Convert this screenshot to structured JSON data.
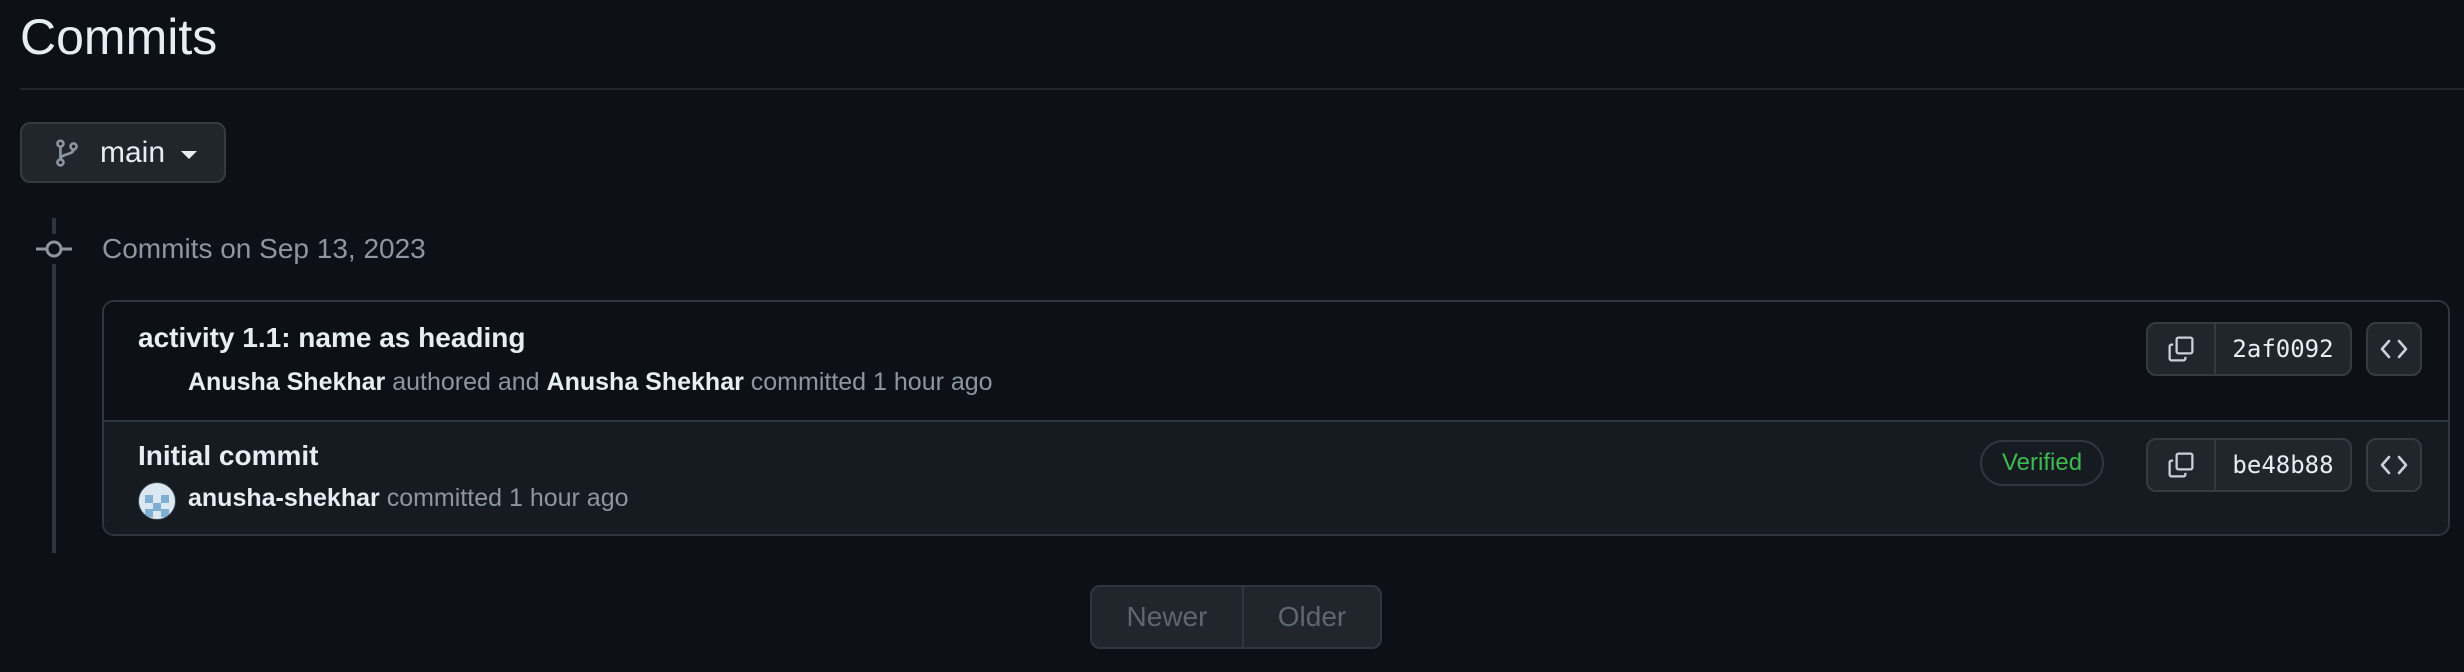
{
  "page": {
    "title": "Commits"
  },
  "branch": {
    "name": "main",
    "icon": "git-branch-icon"
  },
  "group": {
    "heading": "Commits on Sep 13, 2023",
    "icon": "git-commit-icon"
  },
  "commits": [
    {
      "title": "activity 1.1: name as heading",
      "author": "Anusha Shekhar",
      "authored_text": "authored and",
      "committer": "Anusha Shekhar",
      "committed_text": "committed",
      "time": "1 hour ago",
      "sha": "2af0092",
      "verified": null
    },
    {
      "title": "Initial commit",
      "author": "anusha-shekhar",
      "committed_text": "committed",
      "time": "1 hour ago",
      "sha": "be48b88",
      "verified": "Verified"
    }
  ],
  "pagination": {
    "newer": "Newer",
    "older": "Older"
  },
  "colors": {
    "background": "#0d1117",
    "verified": "#3fb950",
    "muted_text": "#8d96a0",
    "border": "#30363d"
  }
}
